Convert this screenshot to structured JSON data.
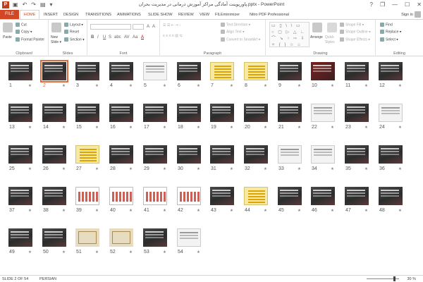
{
  "window": {
    "app_letter": "P",
    "title": "پاورپوینت آمادگی مراکز آموزش درمانی در مدیریت بحران.pptx - PowerPoint",
    "help": "?",
    "restore": "❐",
    "minimize": "—",
    "maximize": "☐",
    "close": "✕"
  },
  "qat": {
    "save": "▣",
    "undo": "↶",
    "redo": "↷",
    "start": "▤",
    "customize": "▾"
  },
  "tabs": {
    "file": "FILE",
    "home": "HOME",
    "others": [
      "INSERT",
      "DESIGN",
      "TRANSITIONS",
      "ANIMATIONS",
      "SLIDE SHOW",
      "REVIEW",
      "VIEW",
      "FILEminimizer",
      "Nitro PDF Professional"
    ],
    "signin": "Sign in"
  },
  "ribbon": {
    "clipboard": {
      "label": "Clipboard",
      "paste": "Paste",
      "cut": "Cut",
      "copy": "Copy ▾",
      "format_painter": "Format Painter"
    },
    "slides": {
      "label": "Slides",
      "new_slide": "New Slide ▾",
      "layout": "Layout ▾",
      "reset": "Reset",
      "section": "Section ▾"
    },
    "font": {
      "label": "Font",
      "bold": "B",
      "italic": "I",
      "underline": "U",
      "strike": "S",
      "shadow": "abc",
      "spacing": "AV",
      "case": "Aa",
      "color": "A"
    },
    "paragraph": {
      "label": "Paragraph",
      "text_direction": "Text Direction ▾",
      "align_text": "Align Text ▾",
      "convert_smartart": "Convert to SmartArt ▾"
    },
    "drawing": {
      "label": "Drawing",
      "arrange": "Arrange",
      "quick_styles": "Quick Styles",
      "shape_fill": "Shape Fill ▾",
      "shape_outline": "Shape Outline ▾",
      "shape_effects": "Shape Effects ▾",
      "shapes_gallery": "▭ ▯ \\ \\ ▭ ○ ▢ ▷ △ ∟ ⌒ ↘ ↑ ⇨ ⇩ ✧ { } ☆ ⌂ ⊏"
    },
    "editing": {
      "label": "Editing",
      "find": "Find",
      "replace": "Replace ▾",
      "select": "Select ▾"
    }
  },
  "slides": [
    {
      "n": "1",
      "s": "★"
    },
    {
      "n": "2",
      "s": "★"
    },
    {
      "n": "3",
      "s": "★"
    },
    {
      "n": "4",
      "s": "★"
    },
    {
      "n": "5",
      "s": "★"
    },
    {
      "n": "6",
      "s": "★"
    },
    {
      "n": "7",
      "s": "★"
    },
    {
      "n": "8",
      "s": "★"
    },
    {
      "n": "9",
      "s": "★"
    },
    {
      "n": "10",
      "s": "★"
    },
    {
      "n": "11",
      "s": "★"
    },
    {
      "n": "12",
      "s": "★"
    },
    {
      "n": "13",
      "s": "★"
    },
    {
      "n": "14",
      "s": "★"
    },
    {
      "n": "15",
      "s": "★"
    },
    {
      "n": "16",
      "s": "★"
    },
    {
      "n": "17",
      "s": "★"
    },
    {
      "n": "18",
      "s": "★"
    },
    {
      "n": "19",
      "s": "★"
    },
    {
      "n": "20",
      "s": "★"
    },
    {
      "n": "21",
      "s": "★"
    },
    {
      "n": "22",
      "s": "★"
    },
    {
      "n": "23",
      "s": "★"
    },
    {
      "n": "24",
      "s": "★"
    },
    {
      "n": "25",
      "s": "★"
    },
    {
      "n": "26",
      "s": "★"
    },
    {
      "n": "27",
      "s": "★"
    },
    {
      "n": "28",
      "s": "★"
    },
    {
      "n": "29",
      "s": "★"
    },
    {
      "n": "30",
      "s": "★"
    },
    {
      "n": "31",
      "s": "★"
    },
    {
      "n": "32",
      "s": "★"
    },
    {
      "n": "33",
      "s": "★"
    },
    {
      "n": "34",
      "s": "★"
    },
    {
      "n": "35",
      "s": "★"
    },
    {
      "n": "36",
      "s": "★"
    },
    {
      "n": "37",
      "s": "★"
    },
    {
      "n": "38",
      "s": "★"
    },
    {
      "n": "39",
      "s": "★"
    },
    {
      "n": "40",
      "s": "★"
    },
    {
      "n": "41",
      "s": "★"
    },
    {
      "n": "42",
      "s": "★"
    },
    {
      "n": "43",
      "s": "★"
    },
    {
      "n": "44",
      "s": "★"
    },
    {
      "n": "45",
      "s": "★"
    },
    {
      "n": "46",
      "s": "★"
    },
    {
      "n": "47",
      "s": "★"
    },
    {
      "n": "48",
      "s": "★"
    },
    {
      "n": "49",
      "s": "★"
    },
    {
      "n": "50",
      "s": "★"
    },
    {
      "n": "51",
      "s": "★"
    },
    {
      "n": "52",
      "s": "★"
    },
    {
      "n": "53",
      "s": "★"
    },
    {
      "n": "54",
      "s": "★"
    }
  ],
  "selected_slide": "2",
  "status": {
    "slide": "SLIDE 2 OF 54",
    "language": "PERSIAN",
    "zoom": "30 %"
  },
  "colors": {
    "accent": "#d24726",
    "selection": "#e06a3a"
  }
}
